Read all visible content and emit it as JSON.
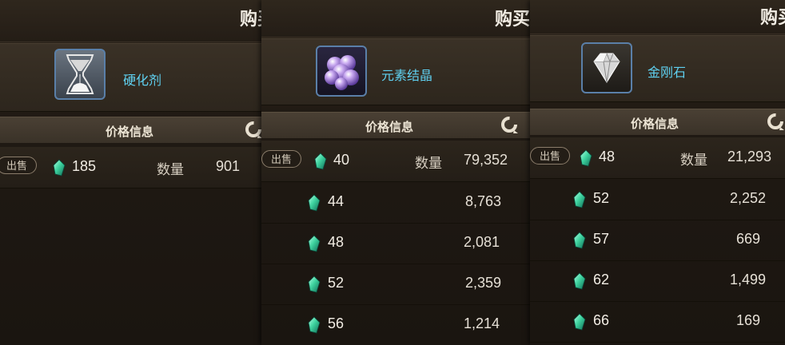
{
  "panels": [
    {
      "buy_label": "购买",
      "item_name": "硬化剂",
      "item_icon": "hourglass-icon",
      "price_info_title": "价格信息",
      "sell_label": "出售",
      "qty_label": "数量",
      "orders": [
        {
          "price": "185",
          "qty": "901"
        }
      ]
    },
    {
      "buy_label": "购买",
      "item_name": "元素结晶",
      "item_icon": "crystal-cluster-icon",
      "price_info_title": "价格信息",
      "sell_label": "出售",
      "qty_label": "数量",
      "orders": [
        {
          "price": "40",
          "qty": "79,352"
        },
        {
          "price": "44",
          "qty": "8,763"
        },
        {
          "price": "48",
          "qty": "2,081"
        },
        {
          "price": "52",
          "qty": "2,359"
        },
        {
          "price": "56",
          "qty": "1,214"
        }
      ]
    },
    {
      "buy_label": "购买",
      "item_name": "金刚石",
      "item_icon": "diamond-icon",
      "price_info_title": "价格信息",
      "sell_label": "出售",
      "qty_label": "数量",
      "orders": [
        {
          "price": "48",
          "qty": "21,293"
        },
        {
          "price": "52",
          "qty": "2,252"
        },
        {
          "price": "57",
          "qty": "669"
        },
        {
          "price": "62",
          "qty": "1,499"
        },
        {
          "price": "66",
          "qty": "169"
        }
      ]
    }
  ],
  "colors": {
    "item_name": "#5fd0f0",
    "gem": "#3fd4a0",
    "background": "#1a1511"
  }
}
